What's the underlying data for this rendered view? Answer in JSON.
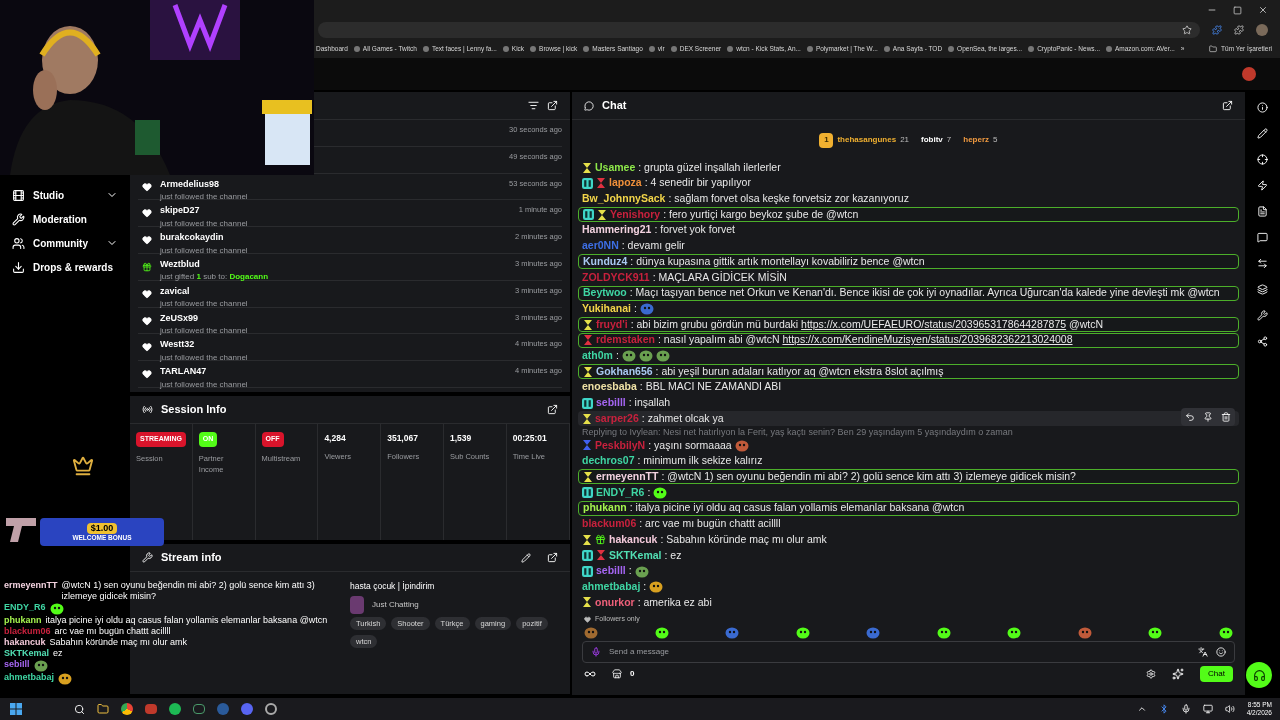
{
  "bookmarks": [
    "Dashboard",
    "All Games - Twitch",
    "Text faces | Lenny fa...",
    "Kick",
    "Browse | kick",
    "Masters Santiago",
    "vlr",
    "DEX Screener",
    "wtcn - Kick Stats, An...",
    "Polymarket | The W...",
    "Ana Sayfa - TOD",
    "OpenSea, the larges...",
    "CryptoPanic - News...",
    "Amazon.com: AVer..."
  ],
  "bookmarks_more": "»",
  "all_bookmarks": "Tüm Yer İşaretleri",
  "nav": [
    {
      "label": "Studio",
      "expandable": true
    },
    {
      "label": "Moderation",
      "expandable": false
    },
    {
      "label": "Community",
      "expandable": true
    },
    {
      "label": "Drops & rewards",
      "expandable": false
    }
  ],
  "activity": [
    {
      "kind": "covered",
      "time": "30 seconds ago"
    },
    {
      "kind": "covered",
      "time": "49 seconds ago"
    },
    {
      "kind": "follow",
      "name": "Armedelius98",
      "text": "just followed the channel",
      "time": "53 seconds ago"
    },
    {
      "kind": "follow",
      "name": "skipeD27",
      "text": "just followed the channel",
      "time": "1 minute ago"
    },
    {
      "kind": "follow",
      "name": "burakcokaydin",
      "text": "just followed the channel",
      "time": "2 minutes ago"
    },
    {
      "kind": "gift",
      "name": "Weztblud",
      "text": "just gifted",
      "count": "1",
      "after": "sub to:",
      "target": "Dogacann",
      "time": "3 minutes ago"
    },
    {
      "kind": "follow",
      "name": "zavical",
      "text": "just followed the channel",
      "time": "3 minutes ago"
    },
    {
      "kind": "follow",
      "name": "ZeUSx99",
      "text": "just followed the channel",
      "time": "3 minutes ago"
    },
    {
      "kind": "follow",
      "name": "Westt32",
      "text": "just followed the channel",
      "time": "4 minutes ago"
    },
    {
      "kind": "follow",
      "name": "TARLAN47",
      "text": "just followed the channel",
      "time": "4 minutes ago"
    }
  ],
  "session": {
    "title": "Session Info",
    "stats": [
      {
        "kind": "badge",
        "badge": "STREAMING",
        "color": "#d9142b",
        "label": "Session"
      },
      {
        "kind": "badge",
        "badge": "ON",
        "color": "#53fc18",
        "label": "Partner Income"
      },
      {
        "kind": "badge",
        "badge": "OFF",
        "color": "#d9142b",
        "label": "Multistream"
      },
      {
        "kind": "stat",
        "value": "4,284",
        "label": "Viewers"
      },
      {
        "kind": "stat",
        "value": "351,067",
        "label": "Followers"
      },
      {
        "kind": "stat",
        "value": "1,539",
        "label": "Sub Counts"
      },
      {
        "kind": "stat",
        "value": "00:25:01",
        "label": "Time Live"
      }
    ]
  },
  "stream": {
    "title": "Stream info",
    "stream_title": "hasta çocuk | İpindirim",
    "category": "Just Chatting",
    "tags": [
      "Turkish",
      "Shooter",
      "Türkçe",
      "gaming",
      "pozitif",
      "wtcn"
    ]
  },
  "overlay": {
    "bonus_amount": "$1.00",
    "bonus_text": "WELCOME BONUS",
    "chat": [
      {
        "user": "ermeyennTT",
        "color": "#f3d3e0",
        "text": "@wtcN 1) sen oyunu beğendin mi abi? 2) golü sence kim attı 3) izlemeye gidicek misin?"
      },
      {
        "user": "ENDY_R6",
        "color": "#3fd6a4",
        "emotes": [
          {
            "kind": "cup"
          }
        ]
      },
      {
        "user": "phukann",
        "color": "#a4f34e",
        "text": "italya picine iyi oldu aq casus falan yollamis elemanlar baksana @wtcn"
      },
      {
        "user": "blackum06",
        "color": "#c8213d",
        "text": "arc vae mı bugün chattt acillll"
      },
      {
        "user": "hakancuk",
        "color": "#f3c9da",
        "text": "Sabahın köründe maç mı olur amk"
      },
      {
        "user": "SKTKemal",
        "color": "#52e0b4",
        "text": "ez"
      },
      {
        "user": "sebiIll",
        "color": "#a565f2",
        "emotes": [
          {
            "kind": "frog"
          }
        ]
      },
      {
        "user": "ahmetbabaj",
        "color": "#3fd6a4",
        "emotes": [
          {
            "kind": "crown"
          }
        ]
      }
    ]
  },
  "chat": {
    "title": "Chat",
    "leaders": [
      {
        "rank": "1",
        "name": "thehasangunes",
        "count": "21",
        "color": "#f0b030"
      },
      {
        "name": "fobitv",
        "count": "7",
        "color": "#ffffff"
      },
      {
        "name": "heperz",
        "count": "5",
        "color": "#f09a40"
      }
    ],
    "messages": [
      {
        "user": "Usamee",
        "color": "#8ee84a",
        "badges": [
          {
            "kind": "hourglass"
          }
        ],
        "text": ": grupta güzel inşallah ilerlerler",
        "highlighted": false
      },
      {
        "user": "lapoza",
        "color": "#f0903a",
        "badges": [
          {
            "kind": "sub"
          },
          {
            "kind": "hourglass-red"
          }
        ],
        "text": ": 4 senedir bir yapılıyor",
        "highlighted": false
      },
      {
        "user": "Bw_JohnnySack",
        "color": "#f3d64a",
        "text": ": sağlam forvet olsa keşke forvetsiz zor kazanıyoruz",
        "highlighted": false
      },
      {
        "user": "Yenishory",
        "color": "#c8213d",
        "badges": [
          {
            "kind": "sub"
          },
          {
            "kind": "hourglass"
          }
        ],
        "text": ": fero yurtiçi kargo beykoz şube de @wtcn",
        "highlighted": true
      },
      {
        "user": "Hammering21",
        "color": "#f3d3e0",
        "text": ": forvet yok forvet",
        "highlighted": false
      },
      {
        "user": "aer0NN",
        "color": "#3d6fe6",
        "text": ": devamı gelir",
        "highlighted": false
      },
      {
        "user": "Kunduz4",
        "color": "#a9c9f2",
        "text": ": dünya kupasına gittik artık montellayı kovabiliriz bence @wtcn",
        "highlighted": true
      },
      {
        "user": "ZOLDYCK911",
        "color": "#c8213d",
        "text": ": MAÇLARA GİDİCEK MİSİN",
        "highlighted": false
      },
      {
        "user": "Beytwoo",
        "color": "#3fd6a4",
        "text": ": Maçı taşıyan bence net Orkun ve Kenan'dı. Bence ikisi de çok iyi oynadılar. Ayrıca Uğurcan'da kalede yine devleşti mk @wtcn",
        "highlighted": true
      },
      {
        "user": "Yukihanai",
        "color": "#f3d64a",
        "text": ":",
        "emotes": [
          {
            "kind": "globe"
          }
        ],
        "highlighted": false
      },
      {
        "user": "fruyd'i",
        "color": "#c8213d",
        "badges": [
          {
            "kind": "hourglass"
          }
        ],
        "text": ": abi bizim grubu gördün mü burdaki",
        "link": "https://x.com/UEFAEURO/status/2039653178644287875",
        "after": "@wtcN",
        "highlighted": true
      },
      {
        "user": "rdemstaken",
        "color": "#c8213d",
        "badges": [
          {
            "kind": "hourglass-red"
          }
        ],
        "text": ": nasıl yapalım abi @wtcN",
        "link": "https://x.com/KendineMuzisyen/status/2039682362213024008",
        "highlighted": true
      },
      {
        "user": "ath0m",
        "color": "#3fd6a4",
        "text": ":",
        "emotes": [
          {
            "kind": "frog"
          },
          {
            "kind": "frog"
          },
          {
            "kind": "frog"
          }
        ],
        "highlighted": false
      },
      {
        "user": "Gokhan656",
        "color": "#a9c9f2",
        "badges": [
          {
            "kind": "hourglass"
          }
        ],
        "text": ": abi yeşil burun adaları katlıyor aq @wtcn ekstra 8slot açılmış",
        "highlighted": true
      },
      {
        "user": "enoesbaba",
        "color": "#efe2a6",
        "text": ": BBL MACI NE ZAMANDI ABI",
        "highlighted": false
      },
      {
        "user": "sebiIll",
        "color": "#a565f2",
        "badges": [
          {
            "kind": "sub"
          }
        ],
        "text": ": inşallah",
        "highlighted": false
      },
      {
        "user": "sarper26",
        "color": "#c8213d",
        "badges": [
          {
            "kind": "hourglass"
          }
        ],
        "text": ": zahmet olcak ya",
        "highlighted": false,
        "hovered": true
      },
      {
        "user": "PeskbilyN",
        "color": "#c8213d",
        "badges": [
          {
            "kind": "hourglass-blue"
          }
        ],
        "reply": "Replying to Ivylean: Nesi net hatırlıyon la Ferit, yaş kaçtı senin? Ben 29 yaşındayım 5 yaşındaydım o zaman",
        "text": ": yaşını sormaaaa",
        "emotes": [
          {
            "kind": "face"
          }
        ],
        "highlighted": false
      },
      {
        "user": "dechros07",
        "color": "#3fd6a4",
        "text": ": minimum ilk sekize kalırız",
        "highlighted": false
      },
      {
        "user": "ermeyennTT",
        "color": "#f3d3e0",
        "badges": [
          {
            "kind": "hourglass"
          }
        ],
        "text": ": @wtcN 1) sen oyunu beğendin mi abi? 2) golü sence kim attı 3) izlemeye gidicek misin?",
        "highlighted": true
      },
      {
        "user": "ENDY_R6",
        "color": "#3fd6a4",
        "badges": [
          {
            "kind": "sub"
          }
        ],
        "text": ":",
        "emotes": [
          {
            "kind": "cup"
          }
        ],
        "highlighted": false
      },
      {
        "user": "phukann",
        "color": "#a4f34e",
        "text": ": italya picine iyi oldu aq casus falan yollamis elemanlar baksana @wtcn",
        "highlighted": true
      },
      {
        "user": "blackum06",
        "color": "#c8213d",
        "text": ": arc vae mı bugün chattt acillll",
        "highlighted": false
      },
      {
        "user": "hakancuk",
        "color": "#f3c9da",
        "badges": [
          {
            "kind": "hourglass"
          },
          {
            "kind": "gift"
          }
        ],
        "text": ": Sabahın köründe maç mı olur amk",
        "highlighted": false
      },
      {
        "user": "SKTKemal",
        "color": "#52e0b4",
        "badges": [
          {
            "kind": "sub"
          },
          {
            "kind": "hourglass-red"
          }
        ],
        "text": ": ez",
        "highlighted": false
      },
      {
        "user": "sebiIll",
        "color": "#a565f2",
        "badges": [
          {
            "kind": "sub"
          }
        ],
        "text": ":",
        "emotes": [
          {
            "kind": "frog"
          }
        ],
        "highlighted": false
      },
      {
        "user": "ahmetbabaj",
        "color": "#3fd6a4",
        "text": ":",
        "emotes": [
          {
            "kind": "crown"
          }
        ],
        "highlighted": false
      },
      {
        "user": "onurkor",
        "color": "#f0607a",
        "badges": [
          {
            "kind": "hourglass"
          }
        ],
        "text": ": amerika ez abi",
        "highlighted": false
      }
    ],
    "mode": "Followers only",
    "quick_emotes": [
      {
        "kind": "box"
      },
      {
        "kind": "blob"
      },
      {
        "kind": "globe"
      },
      {
        "kind": "blob"
      },
      {
        "kind": "globe"
      },
      {
        "kind": "blob"
      },
      {
        "kind": "blob"
      },
      {
        "kind": "face"
      },
      {
        "kind": "blob"
      },
      {
        "kind": "blob"
      }
    ],
    "input": {
      "placeholder": "Send a message"
    },
    "points": "0",
    "send": "Chat"
  },
  "clock": {
    "time": "8:55 PM",
    "date": "4/2/2026"
  }
}
